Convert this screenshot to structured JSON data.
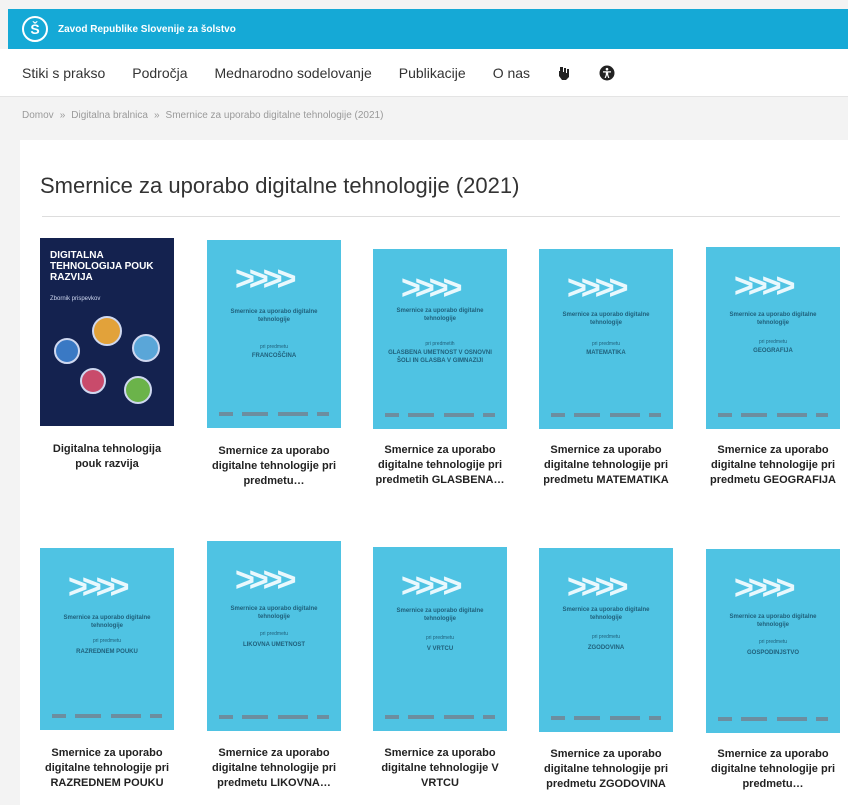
{
  "header": {
    "logo_letter": "Š",
    "org_name": "Zavod Republike Slovenije za šolstvo"
  },
  "nav": {
    "items": [
      "Stiki s prakso",
      "Področja",
      "Mednarodno sodelovanje",
      "Publikacije",
      "O nas"
    ]
  },
  "breadcrumb": [
    "Domov",
    "Digitalna bralnica",
    "Smernice za uporabo digitalne tehnologije (2021)"
  ],
  "breadcrumb_sep": "»",
  "page": {
    "title": "Smernice za uporabo digitalne tehnologije (2021)"
  },
  "cover_text": {
    "title": "Smernice za uporabo digitalne tehnologije",
    "sub": "pri predmetu",
    "sub_plural": "pri predmetih",
    "dark_title": "DIGITALNA TEHNOLOGIJA POUK RAZVIJA",
    "dark_sub": "Zbornik prispevkov"
  },
  "books": [
    {
      "caption": "Digitalna tehnologija pouk razvija",
      "subject": ""
    },
    {
      "caption": "Smernice za uporabo digitalne tehnologije pri predmetu…",
      "subject": "FRANCOŠČINA"
    },
    {
      "caption": "Smernice za uporabo digitalne tehnologije pri predmetih GLASBENA…",
      "subject": "GLASBENA UMETNOST V OSNOVNI ŠOLI IN GLASBA V GIMNAZIJI"
    },
    {
      "caption": "Smernice za uporabo digitalne tehnologije pri predmetu MATEMATIKA",
      "subject": "MATEMATIKA"
    },
    {
      "caption": "Smernice za uporabo digitalne tehnologije pri predmetu GEOGRAFIJA",
      "subject": "GEOGRAFIJA"
    },
    {
      "caption": "Smernice za uporabo digitalne tehnologije pri RAZREDNEM POUKU",
      "subject": "RAZREDNEM POUKU"
    },
    {
      "caption": "Smernice za uporabo digitalne tehnologije pri predmetu LIKOVNA…",
      "subject": "LIKOVNA UMETNOST"
    },
    {
      "caption": "Smernice za uporabo digitalne tehnologije V VRTCU",
      "subject": "V VRTCU"
    },
    {
      "caption": "Smernice za uporabo digitalne tehnologije pri predmetu ZGODOVINA",
      "subject": "ZGODOVINA"
    },
    {
      "caption": "Smernice za uporabo digitalne tehnologije pri predmetu…",
      "subject": "GOSPODINJSTVO"
    }
  ],
  "colors": {
    "header": "#15a9d6",
    "cover": "#4fc3e3",
    "dark_cover": "#14224f"
  }
}
